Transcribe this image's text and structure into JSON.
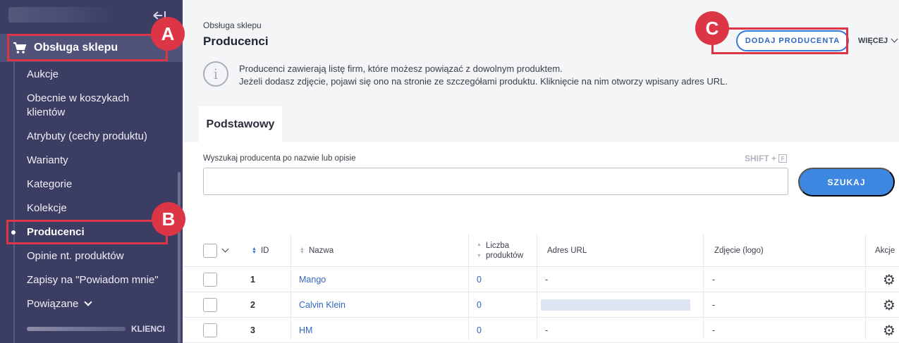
{
  "sidebar": {
    "section_title": "Obsługa sklepu",
    "items": [
      {
        "label": "Aukcje"
      },
      {
        "label": "Obecnie w koszykach klientów"
      },
      {
        "label": "Atrybuty (cechy produktu)"
      },
      {
        "label": "Warianty"
      },
      {
        "label": "Kategorie"
      },
      {
        "label": "Kolekcje"
      },
      {
        "label": "Producenci",
        "active": true
      },
      {
        "label": "Opinie nt. produktów"
      },
      {
        "label": "Zapisy na \"Powiadom mnie\""
      },
      {
        "label": "Powiązane"
      }
    ],
    "footer_label": "KLIENCI"
  },
  "markers": {
    "a": "A",
    "b": "B",
    "c": "C"
  },
  "header": {
    "breadcrumb": "Obsługa sklepu",
    "title": "Producenci",
    "add_button": "DODAJ PRODUCENTA",
    "more_label": "WIĘCEJ"
  },
  "info": {
    "line1": "Producenci zawierają listę firm, które możesz powiązać z dowolnym produktem.",
    "line2": "Jeżeli dodasz zdjęcie, pojawi się ono na stronie ze szczegółami produktu. Kliknięcie na nim otworzy wpisany adres URL."
  },
  "tabs": [
    {
      "label": "Podstawowy"
    }
  ],
  "search": {
    "label": "Wyszukaj producenta po nazwie lub opisie",
    "shortcut": "SHIFT +",
    "shortcut_key": "F",
    "value": "",
    "button": "SZUKAJ"
  },
  "table": {
    "headers": {
      "id": "ID",
      "name": "Nazwa",
      "count": "Liczba produktów",
      "url": "Adres URL",
      "image": "Zdjęcie (logo)",
      "actions": "Akcje"
    },
    "rows": [
      {
        "id": "1",
        "name": "Mango",
        "count": "0",
        "url": "-",
        "image": "-"
      },
      {
        "id": "2",
        "name": "Calvin Klein",
        "count": "0",
        "url": "",
        "image": "-"
      },
      {
        "id": "3",
        "name": "HM",
        "count": "0",
        "url": "-",
        "image": "-"
      }
    ]
  }
}
